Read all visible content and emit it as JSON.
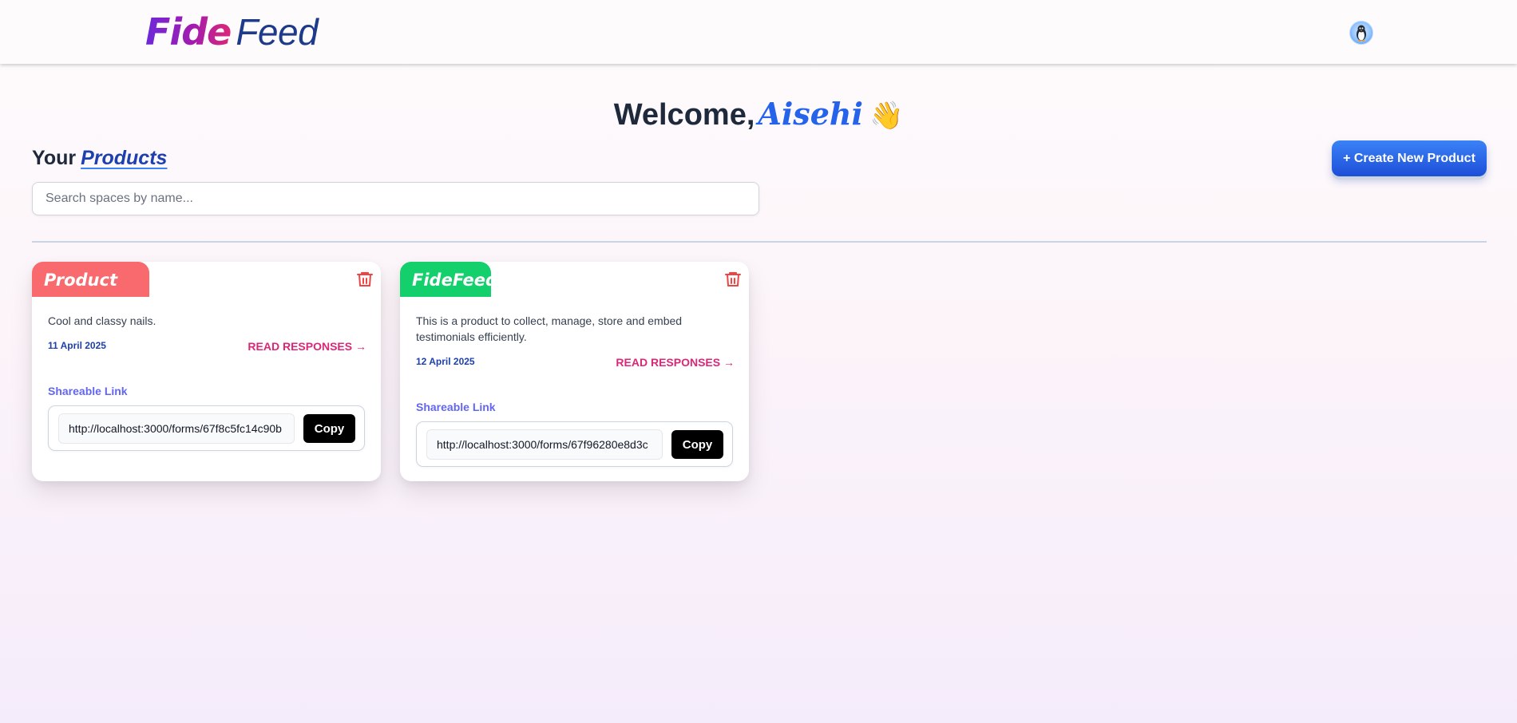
{
  "header": {
    "logo_part1": "Fide",
    "logo_part2": "Feed",
    "avatar_icon": "penguin-avatar"
  },
  "welcome": {
    "greeting": "Welcome,",
    "name": "Aisehi",
    "emoji": "👋"
  },
  "section": {
    "title_prefix": "Your",
    "title_highlight": "Products",
    "create_button": "+ Create New Product"
  },
  "search": {
    "placeholder": "Search spaces by name...",
    "value": ""
  },
  "products": [
    {
      "name": "Product One",
      "tag_color": "#f86a6d",
      "description": "Cool and classy nails.",
      "date": "11 April 2025",
      "read_label": "READ RESPONSES →",
      "share_label": "Shareable Link",
      "link": "http://localhost:3000/forms/67f8c5fc14c90b",
      "copy_label": "Copy",
      "delete_icon": "trash-icon"
    },
    {
      "name": "FideFeed",
      "tag_color": "#13cf6c",
      "description": "This is a product to collect, manage, store and embed testimonials efficiently.",
      "date": "12 April 2025",
      "read_label": "READ RESPONSES →",
      "share_label": "Shareable Link",
      "link": "http://localhost:3000/forms/67f96280e8d3c",
      "copy_label": "Copy",
      "delete_icon": "trash-icon"
    }
  ],
  "colors": {
    "accent_blue": "#2563eb",
    "accent_pink": "#db2777",
    "danger_red": "#ef4444"
  }
}
